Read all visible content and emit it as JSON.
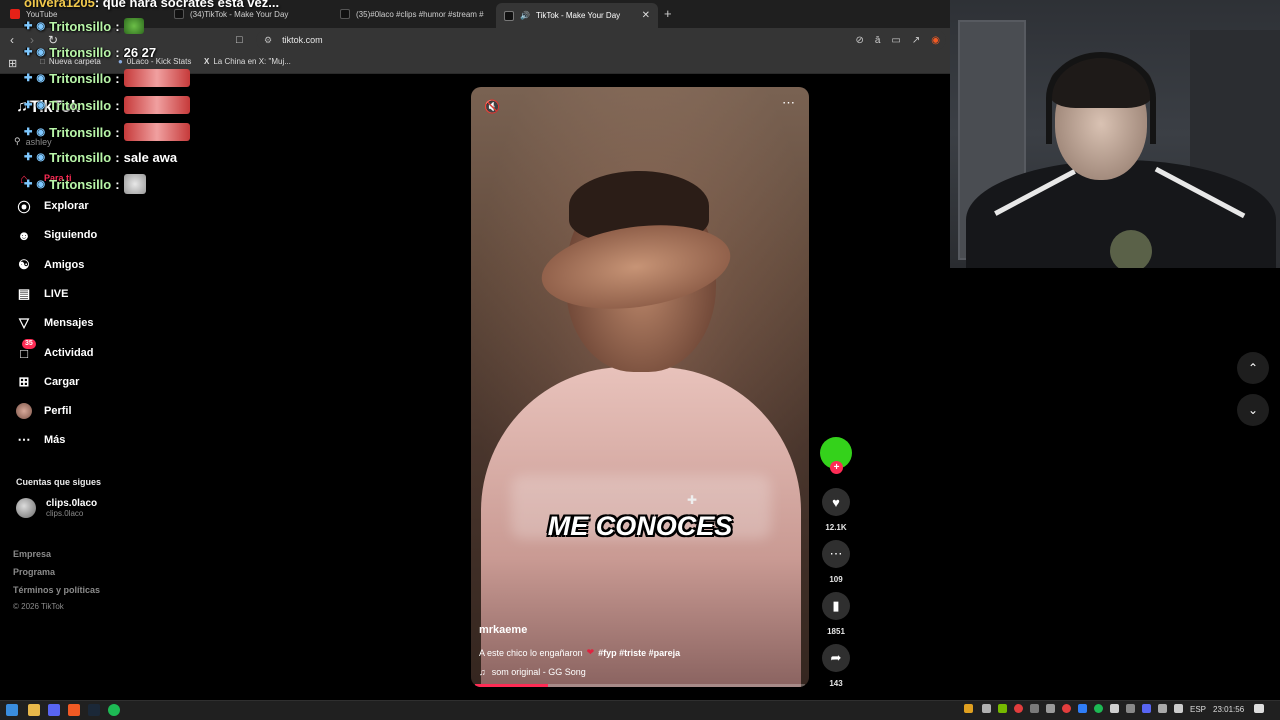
{
  "browser": {
    "tabs": [
      {
        "label": "YouTube",
        "active": false
      },
      {
        "label": "(34)TikTok - Make Your Day",
        "active": false
      },
      {
        "label": "(35)#0laco #clips #humor #stream #",
        "active": false
      },
      {
        "label": "TikTok - Make Your Day",
        "active": true
      }
    ],
    "url": "tiktok.com",
    "bookmarks": [
      "Nueva carpeta",
      "0Laco - Kick Stats",
      "La China en X: \"Muj..."
    ]
  },
  "tiktok": {
    "logo": "TikTok",
    "search_placeholder": "ashley",
    "nav": [
      {
        "label": "Para ti",
        "icon": "home-icon"
      },
      {
        "label": "Explorar",
        "icon": "compass-icon"
      },
      {
        "label": "Siguiendo",
        "icon": "following-icon"
      },
      {
        "label": "Amigos",
        "icon": "friends-icon"
      },
      {
        "label": "LIVE",
        "icon": "live-icon"
      },
      {
        "label": "Mensajes",
        "icon": "messages-icon"
      },
      {
        "label": "Actividad",
        "icon": "activity-icon",
        "badge": "35"
      },
      {
        "label": "Cargar",
        "icon": "upload-icon"
      },
      {
        "label": "Perfil",
        "icon": "profile-avatar"
      },
      {
        "label": "Más",
        "icon": "more-icon"
      }
    ],
    "following_title": "Cuentas que sigues",
    "following": [
      {
        "name": "clips.0laco",
        "handle": "clips.0laco"
      }
    ],
    "footer": [
      "Empresa",
      "Programa",
      "Términos y políticas"
    ],
    "copyright": "© 2026 TikTok"
  },
  "video": {
    "overlay_caption": "ME CONOCES",
    "author": "mrkaeme",
    "description": "A este chico lo engañaron",
    "hashtags": "#fyp #triste #pareja",
    "music": "som original - GG Song",
    "progress": 0.22
  },
  "actions": {
    "likes": "12.1K",
    "comments": "109",
    "saves": "1851",
    "shares": "143"
  },
  "chat": {
    "top_user": "olivera1205",
    "top_text": ": que hara socrates esta vez...",
    "messages": [
      {
        "user": "Tritonsillo",
        "text": "",
        "emote": "frog"
      },
      {
        "user": "Tritonsillo",
        "text": "26 27",
        "emote": ""
      },
      {
        "user": "Tritonsillo",
        "text": "",
        "emote": "red"
      },
      {
        "user": "Tritonsillo",
        "text": "",
        "emote": "red"
      },
      {
        "user": "Tritonsillo",
        "text": "",
        "emote": "red"
      },
      {
        "user": "Tritonsillo",
        "text": "sale awa",
        "emote": ""
      },
      {
        "user": "Tritonsillo",
        "text": "",
        "emote": "cat"
      }
    ]
  },
  "taskbar": {
    "language": "ESP",
    "time": "23:01:56"
  },
  "colors": {
    "accent": "#fe2c55",
    "background": "#000000",
    "chrome": "#353535"
  }
}
